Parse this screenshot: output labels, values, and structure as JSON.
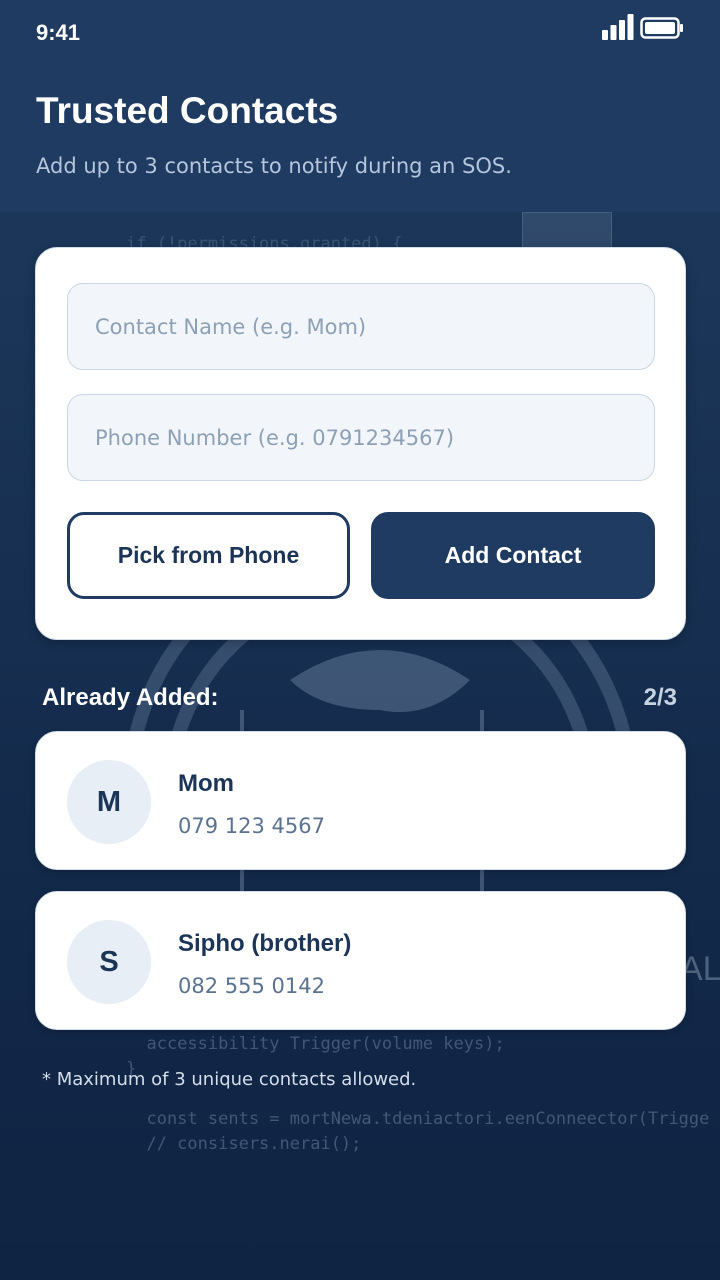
{
  "status_bar": {
    "time": "9:41",
    "signal_icon": "signal-bars-icon",
    "battery_icon": "battery-icon"
  },
  "header": {
    "title": "Trusted Contacts",
    "subtitle": "Add up to 3 contacts to notify during an SOS."
  },
  "form": {
    "name_placeholder": "Contact Name (e.g. Mom)",
    "phone_placeholder": "Phone Number (e.g. 0791234567)",
    "pick_label": "Pick from Phone",
    "add_label": "Add Contact"
  },
  "contacts_section": {
    "label": "Already Added:",
    "count": "2/3",
    "items": [
      {
        "initial": "M",
        "name": "Mom",
        "phone": "079 123 4567"
      },
      {
        "initial": "S",
        "name": "Sipho (brother)",
        "phone": "082 555 0142"
      }
    ]
  },
  "footnote": "* Maximum of 3 unique contacts allowed.",
  "colors": {
    "primary": "#1f3b62",
    "card_bg": "#ffffff",
    "input_bg": "#f2f6fa",
    "avatar_bg": "#e8eef5",
    "muted_text": "#5c7390"
  }
}
